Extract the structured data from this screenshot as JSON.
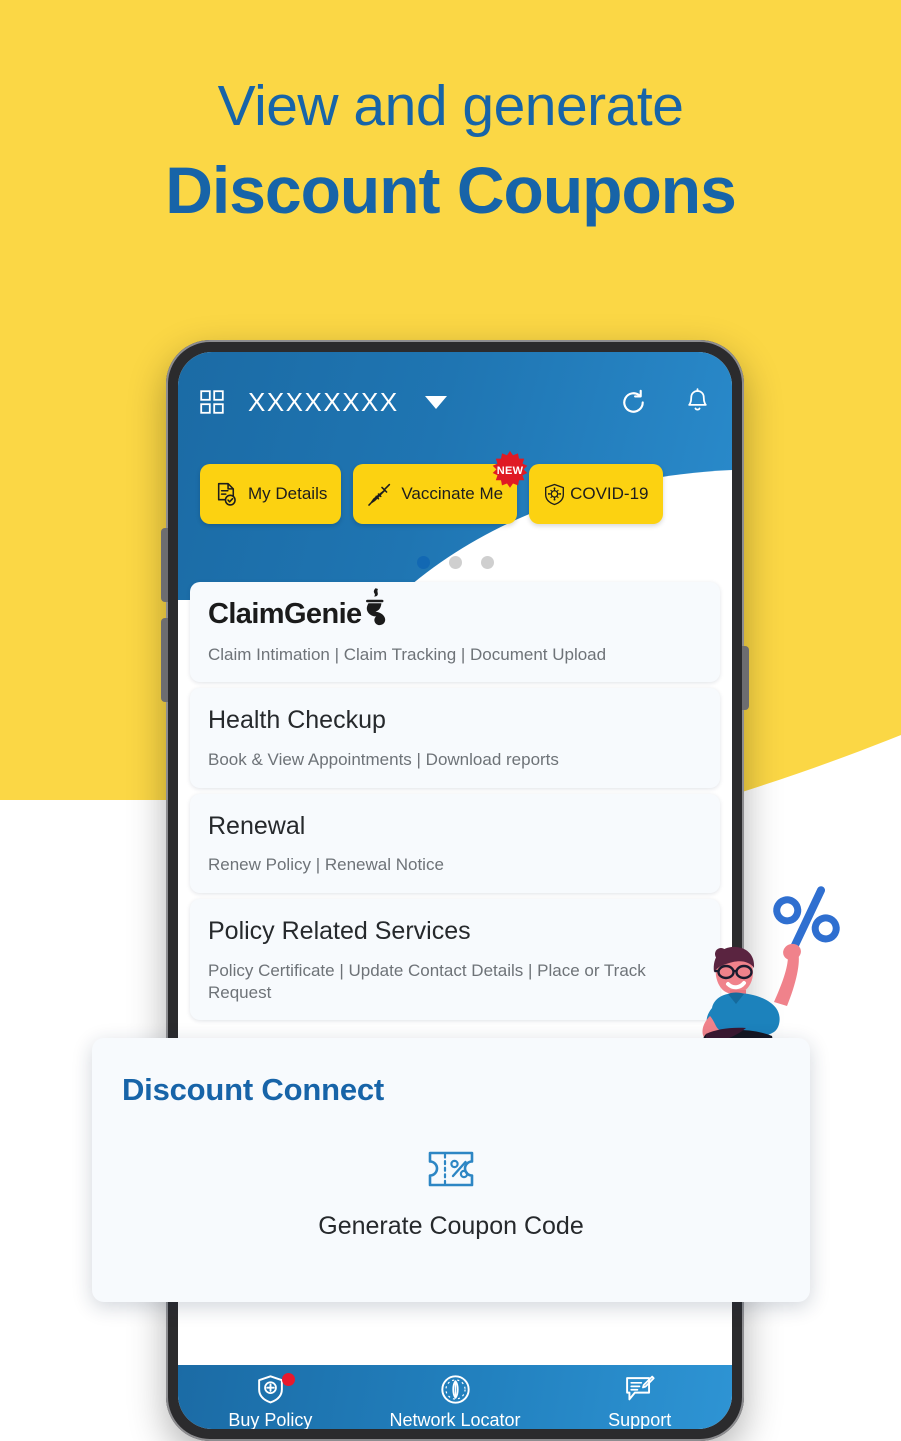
{
  "theme": {
    "yellow": "#FBD745",
    "brand_blue": "#1764a8",
    "chip_yellow": "#fcd211",
    "accent_red": "#e8192c",
    "header_blue": "#1f75b2"
  },
  "headline": {
    "line1": "View and generate",
    "line2": "Discount Coupons"
  },
  "phone": {
    "app_bar": {
      "grid_icon": "grid-menu-icon",
      "title": "XXXXXXXX",
      "caret_icon": "chevron-down-icon",
      "refresh_icon": "refresh-icon",
      "bell_icon": "bell-icon"
    },
    "chips": [
      {
        "label": "My Details",
        "icon": "document-check-icon",
        "badge": ""
      },
      {
        "label": "Vaccinate Me",
        "icon": "syringe-icon",
        "badge": "NEW"
      },
      {
        "label": "COVID-19",
        "icon": "shield-virus-icon",
        "badge": ""
      }
    ],
    "carousel": {
      "dot_count": 3,
      "active_index": 0
    },
    "cards": [
      {
        "title": "ClaimGenie",
        "is_logo": true,
        "logo_icon": "genie-lamp-icon",
        "subtitle": "Claim Intimation | Claim Tracking | Document Upload"
      },
      {
        "title": "Health Checkup",
        "is_logo": false,
        "subtitle": "Book & View Appointments | Download reports"
      },
      {
        "title": "Renewal",
        "is_logo": false,
        "subtitle": "Renew Policy | Renewal Notice"
      },
      {
        "title": "Policy Related Services",
        "is_logo": false,
        "subtitle": "Policy Certificate | Update Contact Details | Place or Track Request"
      }
    ],
    "bottom_nav": [
      {
        "label": "Buy Policy",
        "icon": "shield-plus-icon",
        "has_dot": true
      },
      {
        "label": "Network Locator",
        "icon": "compass-icon",
        "has_dot": false
      },
      {
        "label": "Support",
        "icon": "chat-edit-icon",
        "has_dot": false
      }
    ]
  },
  "discount_card": {
    "title": "Discount Connect",
    "coupon_icon": "coupon-percent-icon",
    "coupon_label": "Generate Coupon Code"
  },
  "illustration": {
    "name": "man-holding-percent-sign",
    "percent_symbol": "%"
  }
}
